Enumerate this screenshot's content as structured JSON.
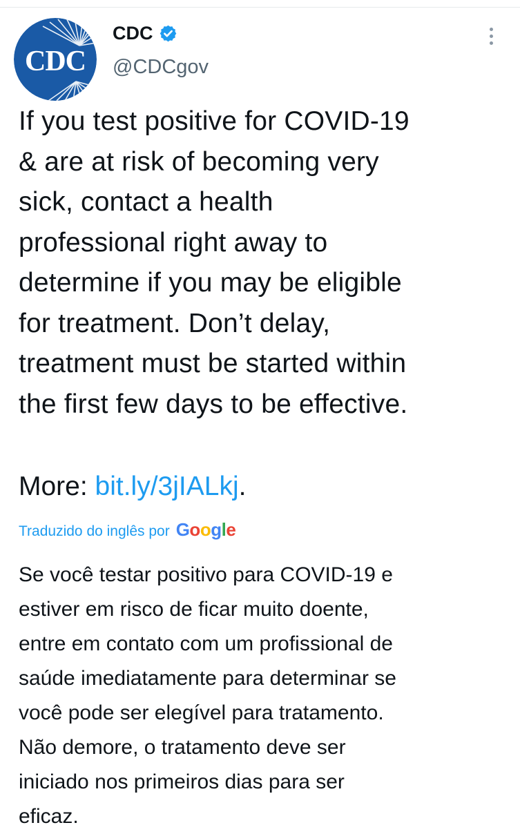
{
  "tweet": {
    "author": {
      "display_name": "CDC",
      "handle": "@CDCgov",
      "avatar_text": "CDC",
      "verified": true,
      "avatar_color": "#1a5aa6"
    },
    "text_lines": [
      "If you test positive for COVID-19",
      "& are at risk of becoming very",
      "sick, contact a health",
      "professional right away to",
      "determine if you may be eligible",
      "for treatment. Don’t delay,",
      "treatment must be started within",
      "the first few days to be effective."
    ],
    "more_prefix": "More: ",
    "link_text": "bit.ly/3jIALkj",
    "more_suffix": ".",
    "translated_label": "Traduzido do inglês por",
    "translator_brand": "Google",
    "translation_lines": [
      "Se você testar positivo para COVID-19 e",
      "estiver em risco de ficar muito doente,",
      "entre em contato com um profissional de",
      "saúde imediatamente para determinar se",
      "você pode ser elegível para tratamento.",
      "Não demore, o tratamento deve ser",
      "iniciado nos primeiros dias para ser",
      "eficaz."
    ],
    "colors": {
      "link": "#1d9bf0",
      "text": "#0f1419",
      "secondary": "#536471",
      "verified": "#1d9bf0"
    },
    "icons": [
      "cdc-logo-icon",
      "verified-badge-icon",
      "more-options-icon",
      "google-logo-icon"
    ]
  }
}
